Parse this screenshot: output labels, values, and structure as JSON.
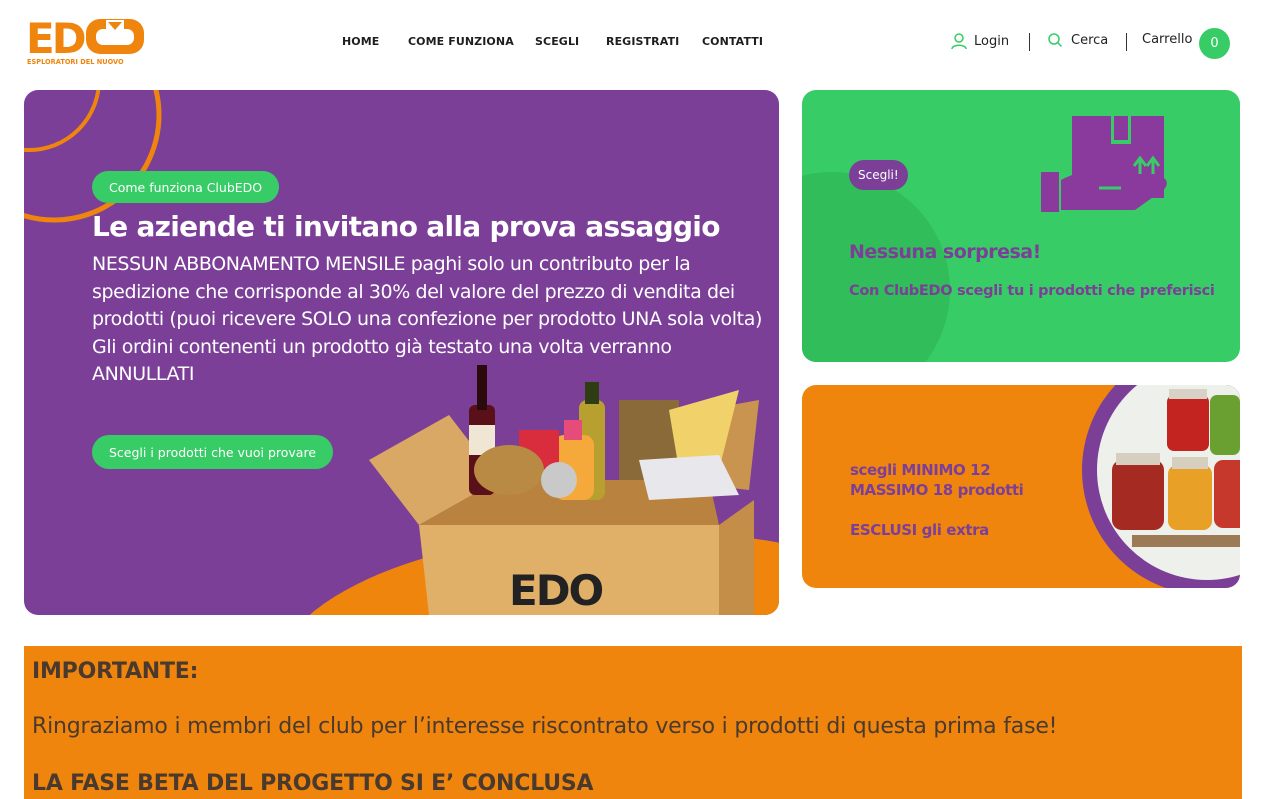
{
  "brand": {
    "logo_text": "EDO",
    "tagline": "ESPLORATORI DEL NUOVO",
    "color_orange": "#f0850e",
    "color_purple": "#7b3f98",
    "color_green": "#38cc66"
  },
  "nav": {
    "items": [
      "HOME",
      "COME FUNZIONA",
      "SCEGLI",
      "REGISTRATI",
      "CONTATTI"
    ]
  },
  "header_actions": {
    "login_label": "Login",
    "search_label": "Cerca",
    "cart_label": "Carrello",
    "cart_count": "0"
  },
  "hero": {
    "badge": "Come funziona ClubEDO",
    "title": "Le aziende ti invitano alla prova assaggio",
    "description": "NESSUN ABBONAMENTO MENSILE paghi solo un contributo per la spedizione che corrisponde al 30% del valore del prezzo di vendita dei prodotti (puoi ricevere SOLO una confezione per prodotto UNA sola volta)",
    "note": "Gli ordini contenenti un prodotto già testato una volta verranno ANNULLATI",
    "cta_label": "Scegli i prodotti che vuoi provare",
    "box_brand": "EDO"
  },
  "card_choose": {
    "badge": "Scegli!",
    "title": "Nessuna sorpresa!",
    "subtitle": "Con ClubEDO scegli tu i prodotti che preferisci",
    "icon": "hand-box-icon"
  },
  "card_quantity": {
    "line1": "scegli MINIMO 12",
    "line2": "MASSIMO 18 prodotti",
    "line3": "ESCLUSI gli extra"
  },
  "announcement": {
    "heading": "IMPORTANTE:",
    "message": "Ringraziamo i membri del club per l’interesse riscontrato verso i prodotti di questa prima fase!",
    "footer_heading": "LA FASE BETA DEL PROGETTO SI E’ CONCLUSA"
  }
}
